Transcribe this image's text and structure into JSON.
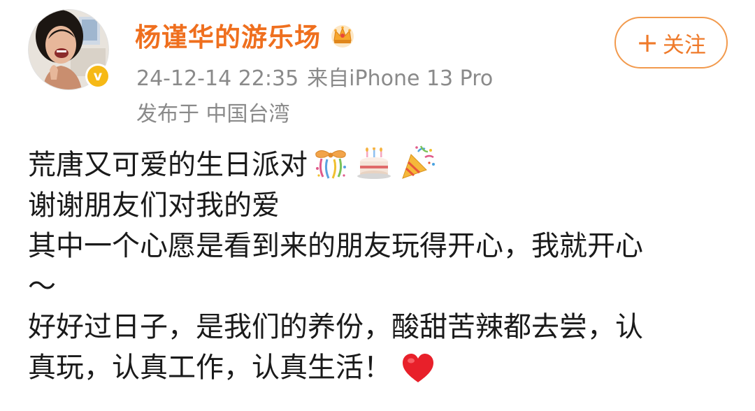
{
  "user": {
    "name": "杨谨华的游乐场",
    "verified_mark": "v",
    "badge_icon": "crown-icon"
  },
  "meta": {
    "timestamp": "24-12-14 22:35",
    "source": "来自iPhone 13 Pro",
    "location": "发布于 中国台湾"
  },
  "follow_button": {
    "plus": "+",
    "label": "关注"
  },
  "post": {
    "lines": [
      "荒唐又可爱的生日派对",
      "谢谢朋友们对我的爱",
      "其中一个心愿是看到来的朋友玩得开心，我就开心",
      "～",
      "好好过日子，是我们的养份，酸甜苦辣都去尝，认",
      "真玩，认真工作，认真生活！"
    ],
    "emojis": [
      "ribbon-gift-icon",
      "birthday-cake-icon",
      "party-popper-icon",
      "red-heart-icon"
    ]
  },
  "colors": {
    "username": "#ef6f1e",
    "meta": "#8a8a8a",
    "follow_border": "#f29a4d",
    "verified": "#f6b916",
    "text": "#1a1a1a"
  }
}
